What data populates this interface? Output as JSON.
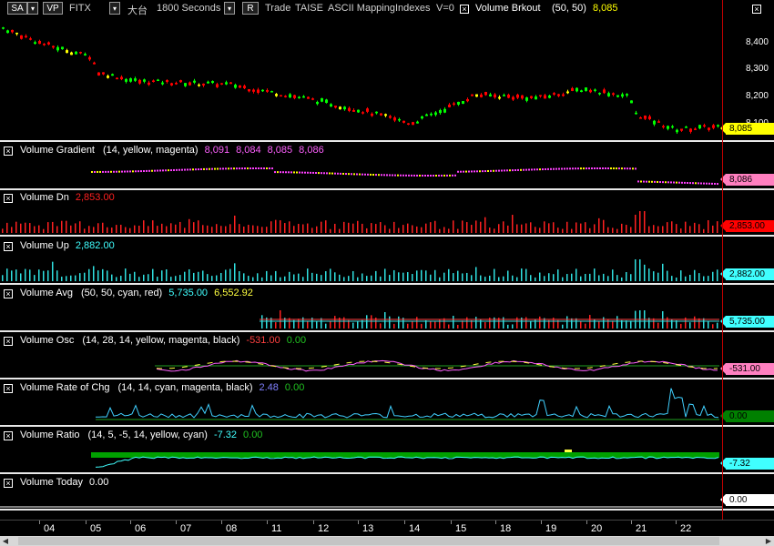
{
  "toolbar": {
    "symbol_btn": "SA",
    "vp_btn": "VP",
    "symbol": "FITX",
    "exchange": "大台",
    "interval": "1800 Seconds",
    "r_btn": "R",
    "mode": "Trade",
    "source": "TAISE",
    "mapping": "ASCII Mapping",
    "indexes": "Indexes",
    "v_setting": "V=0",
    "study_name": "Volume Brkout",
    "study_params": "(50, 50)",
    "study_value": "8,085",
    "close_icon": "x-icon"
  },
  "price_pane": {
    "ticks": [
      "8,400",
      "8,300",
      "8,200",
      "8,100"
    ],
    "ylim": [
      8065,
      8470
    ],
    "last_price": "8,085",
    "flag_color": "#ffff00"
  },
  "panes": [
    {
      "id": "volume-gradient",
      "title": "Volume Gradient",
      "params": "(14, yellow, magenta)",
      "values": [
        "8,091",
        "8,084",
        "8,085",
        "8,086"
      ],
      "value_colors": [
        "#ff60ff",
        "#ff60ff",
        "#ff60ff",
        "#ff60ff"
      ],
      "flag": "8,086",
      "flag_color": "#ff7fbf"
    },
    {
      "id": "volume-dn",
      "title": "Volume Dn",
      "params": "",
      "values": [
        "2,853.00"
      ],
      "value_colors": [
        "#ff2020"
      ],
      "flag": "2,853.00",
      "flag_color": "#ff0000"
    },
    {
      "id": "volume-up",
      "title": "Volume Up",
      "params": "",
      "values": [
        "2,882.00"
      ],
      "value_colors": [
        "#40ffff"
      ],
      "flag": "2,882.00",
      "flag_color": "#40ffff"
    },
    {
      "id": "volume-avg",
      "title": "Volume Avg",
      "params": "(50, 50, cyan, red)",
      "values": [
        "5,735.00",
        "6,552.92"
      ],
      "value_colors": [
        "#40ffff",
        "#ffff40"
      ],
      "flag": "5,735.00",
      "flag_color": "#40ffff"
    },
    {
      "id": "volume-osc",
      "title": "Volume Osc",
      "params": "(14, 28, 14, yellow, magenta, black)",
      "values": [
        "-531.00",
        "0.00"
      ],
      "value_colors": [
        "#ff4040",
        "#20c020"
      ],
      "flag": "-531.00",
      "flag_color": "#ff80c0"
    },
    {
      "id": "volume-rate-of-chg",
      "title": "Volume Rate of Chg",
      "params": "(14, 14, cyan, magenta, black)",
      "values": [
        "2.48",
        "0.00"
      ],
      "value_colors": [
        "#8080ff",
        "#20c020"
      ],
      "flag": "0.00",
      "flag_color": "#008000"
    },
    {
      "id": "volume-ratio",
      "title": "Volume Ratio",
      "params": "(14, 5, -5, 14, yellow, cyan)",
      "values": [
        "-7.32",
        "0.00"
      ],
      "value_colors": [
        "#40ffff",
        "#20c020"
      ],
      "flag": "-7.32",
      "flag_color": "#40ffff"
    },
    {
      "id": "volume-today",
      "title": "Volume Today",
      "params": "",
      "values": [
        "0.00"
      ],
      "value_colors": [
        "#ffffff"
      ],
      "flag": "0.00",
      "flag_color": "#ffffff"
    }
  ],
  "dates": [
    "04",
    "05",
    "06",
    "07",
    "08",
    "11",
    "12",
    "13",
    "14",
    "15",
    "18",
    "19",
    "20",
    "21",
    "22"
  ],
  "colors": {
    "up": "#00ff00",
    "down": "#ff0000",
    "neutral": "#ffff00",
    "divider": "#e8e8e8",
    "cursor": "#c00000"
  }
}
